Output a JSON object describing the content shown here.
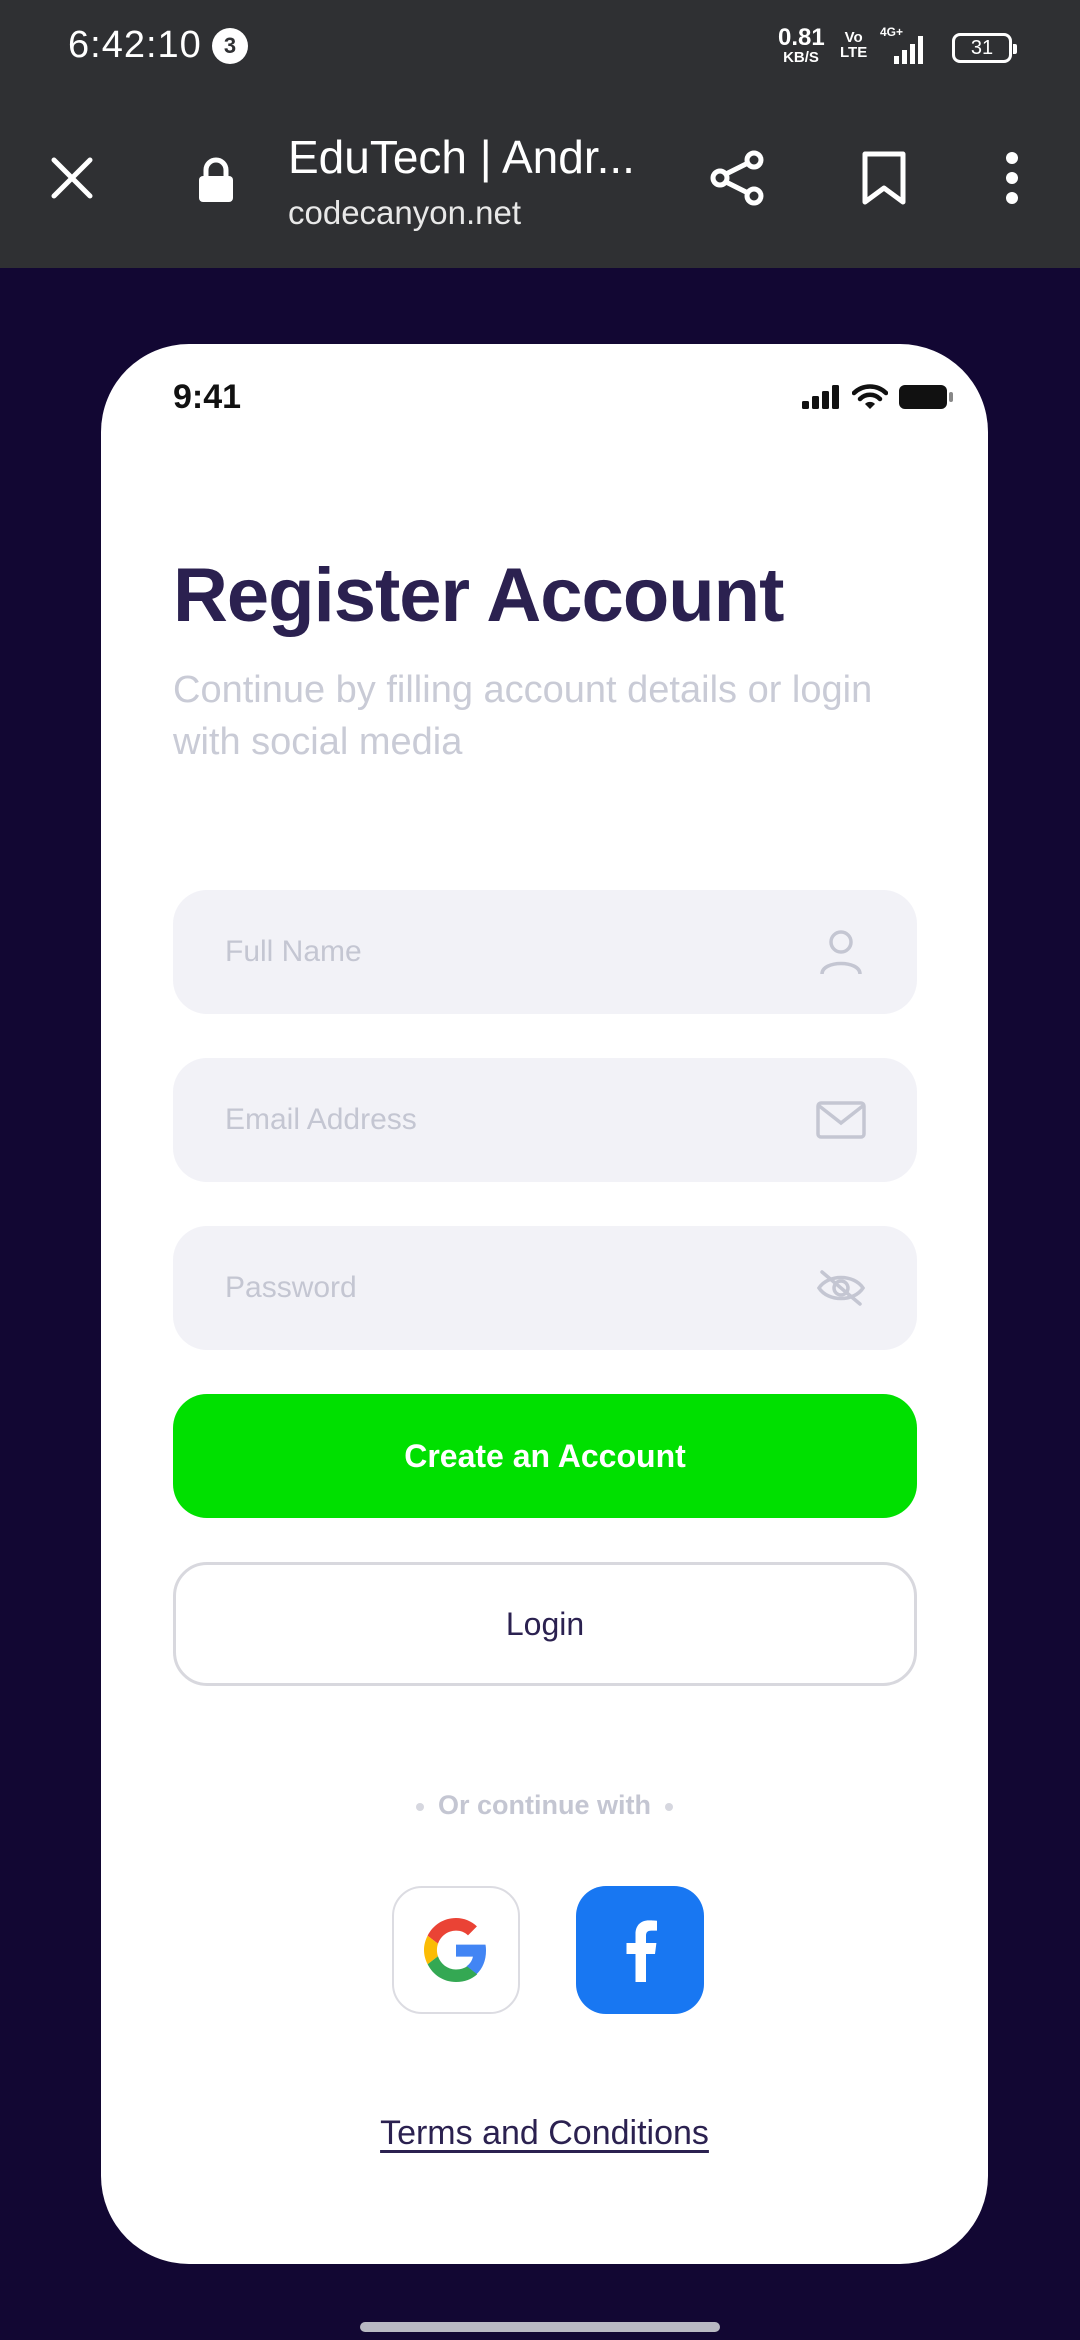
{
  "status_bar": {
    "time": "6:42:10",
    "notification_count": "3",
    "net_speed_value": "0.81",
    "net_speed_unit": "KB/S",
    "volte_top": "Vo",
    "volte_bottom": "LTE",
    "network": "4G+",
    "battery": "31"
  },
  "browser": {
    "title": "EduTech | Andr...",
    "domain": "codecanyon.net",
    "icons": [
      "close-icon",
      "lock-icon",
      "share-icon",
      "bookmark-icon",
      "more-vert-icon"
    ]
  },
  "phone": {
    "status_time": "9:41",
    "title": "Register Account",
    "subtitle": "Continue by filling account details or login with social media",
    "fields": {
      "full_name_placeholder": "Full Name",
      "email_placeholder": "Email Address",
      "password_placeholder": "Password"
    },
    "create_button": "Create an Account",
    "login_button": "Login",
    "divider": "Or continue with",
    "social": [
      "google",
      "facebook"
    ],
    "terms": "Terms and Conditions"
  },
  "colors": {
    "background": "#120733",
    "primary_green": "#00e000",
    "title": "#2b2150",
    "facebook_blue": "#1877f2",
    "chrome_bar": "#2f3033"
  }
}
